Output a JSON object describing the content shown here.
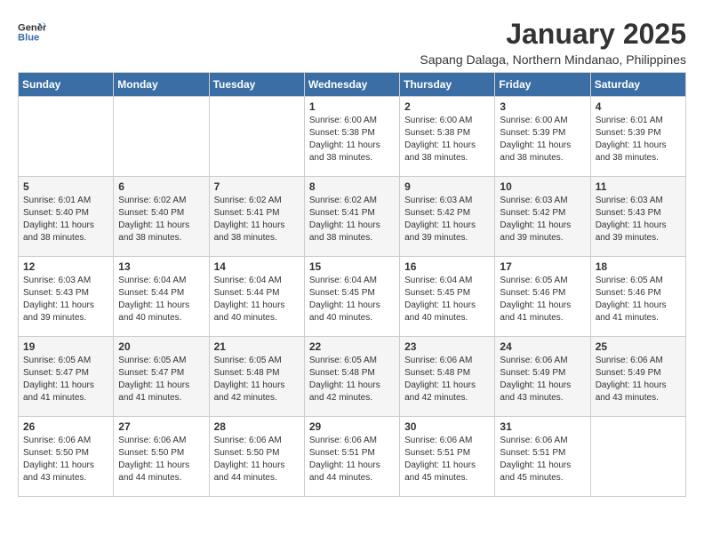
{
  "header": {
    "logo_general": "General",
    "logo_blue": "Blue",
    "month_title": "January 2025",
    "location": "Sapang Dalaga, Northern Mindanao, Philippines"
  },
  "days_of_week": [
    "Sunday",
    "Monday",
    "Tuesday",
    "Wednesday",
    "Thursday",
    "Friday",
    "Saturday"
  ],
  "weeks": [
    [
      {
        "day": "",
        "sunrise": "",
        "sunset": "",
        "daylight": ""
      },
      {
        "day": "",
        "sunrise": "",
        "sunset": "",
        "daylight": ""
      },
      {
        "day": "",
        "sunrise": "",
        "sunset": "",
        "daylight": ""
      },
      {
        "day": "1",
        "sunrise": "Sunrise: 6:00 AM",
        "sunset": "Sunset: 5:38 PM",
        "daylight": "Daylight: 11 hours and 38 minutes."
      },
      {
        "day": "2",
        "sunrise": "Sunrise: 6:00 AM",
        "sunset": "Sunset: 5:38 PM",
        "daylight": "Daylight: 11 hours and 38 minutes."
      },
      {
        "day": "3",
        "sunrise": "Sunrise: 6:00 AM",
        "sunset": "Sunset: 5:39 PM",
        "daylight": "Daylight: 11 hours and 38 minutes."
      },
      {
        "day": "4",
        "sunrise": "Sunrise: 6:01 AM",
        "sunset": "Sunset: 5:39 PM",
        "daylight": "Daylight: 11 hours and 38 minutes."
      }
    ],
    [
      {
        "day": "5",
        "sunrise": "Sunrise: 6:01 AM",
        "sunset": "Sunset: 5:40 PM",
        "daylight": "Daylight: 11 hours and 38 minutes."
      },
      {
        "day": "6",
        "sunrise": "Sunrise: 6:02 AM",
        "sunset": "Sunset: 5:40 PM",
        "daylight": "Daylight: 11 hours and 38 minutes."
      },
      {
        "day": "7",
        "sunrise": "Sunrise: 6:02 AM",
        "sunset": "Sunset: 5:41 PM",
        "daylight": "Daylight: 11 hours and 38 minutes."
      },
      {
        "day": "8",
        "sunrise": "Sunrise: 6:02 AM",
        "sunset": "Sunset: 5:41 PM",
        "daylight": "Daylight: 11 hours and 38 minutes."
      },
      {
        "day": "9",
        "sunrise": "Sunrise: 6:03 AM",
        "sunset": "Sunset: 5:42 PM",
        "daylight": "Daylight: 11 hours and 39 minutes."
      },
      {
        "day": "10",
        "sunrise": "Sunrise: 6:03 AM",
        "sunset": "Sunset: 5:42 PM",
        "daylight": "Daylight: 11 hours and 39 minutes."
      },
      {
        "day": "11",
        "sunrise": "Sunrise: 6:03 AM",
        "sunset": "Sunset: 5:43 PM",
        "daylight": "Daylight: 11 hours and 39 minutes."
      }
    ],
    [
      {
        "day": "12",
        "sunrise": "Sunrise: 6:03 AM",
        "sunset": "Sunset: 5:43 PM",
        "daylight": "Daylight: 11 hours and 39 minutes."
      },
      {
        "day": "13",
        "sunrise": "Sunrise: 6:04 AM",
        "sunset": "Sunset: 5:44 PM",
        "daylight": "Daylight: 11 hours and 40 minutes."
      },
      {
        "day": "14",
        "sunrise": "Sunrise: 6:04 AM",
        "sunset": "Sunset: 5:44 PM",
        "daylight": "Daylight: 11 hours and 40 minutes."
      },
      {
        "day": "15",
        "sunrise": "Sunrise: 6:04 AM",
        "sunset": "Sunset: 5:45 PM",
        "daylight": "Daylight: 11 hours and 40 minutes."
      },
      {
        "day": "16",
        "sunrise": "Sunrise: 6:04 AM",
        "sunset": "Sunset: 5:45 PM",
        "daylight": "Daylight: 11 hours and 40 minutes."
      },
      {
        "day": "17",
        "sunrise": "Sunrise: 6:05 AM",
        "sunset": "Sunset: 5:46 PM",
        "daylight": "Daylight: 11 hours and 41 minutes."
      },
      {
        "day": "18",
        "sunrise": "Sunrise: 6:05 AM",
        "sunset": "Sunset: 5:46 PM",
        "daylight": "Daylight: 11 hours and 41 minutes."
      }
    ],
    [
      {
        "day": "19",
        "sunrise": "Sunrise: 6:05 AM",
        "sunset": "Sunset: 5:47 PM",
        "daylight": "Daylight: 11 hours and 41 minutes."
      },
      {
        "day": "20",
        "sunrise": "Sunrise: 6:05 AM",
        "sunset": "Sunset: 5:47 PM",
        "daylight": "Daylight: 11 hours and 41 minutes."
      },
      {
        "day": "21",
        "sunrise": "Sunrise: 6:05 AM",
        "sunset": "Sunset: 5:48 PM",
        "daylight": "Daylight: 11 hours and 42 minutes."
      },
      {
        "day": "22",
        "sunrise": "Sunrise: 6:05 AM",
        "sunset": "Sunset: 5:48 PM",
        "daylight": "Daylight: 11 hours and 42 minutes."
      },
      {
        "day": "23",
        "sunrise": "Sunrise: 6:06 AM",
        "sunset": "Sunset: 5:48 PM",
        "daylight": "Daylight: 11 hours and 42 minutes."
      },
      {
        "day": "24",
        "sunrise": "Sunrise: 6:06 AM",
        "sunset": "Sunset: 5:49 PM",
        "daylight": "Daylight: 11 hours and 43 minutes."
      },
      {
        "day": "25",
        "sunrise": "Sunrise: 6:06 AM",
        "sunset": "Sunset: 5:49 PM",
        "daylight": "Daylight: 11 hours and 43 minutes."
      }
    ],
    [
      {
        "day": "26",
        "sunrise": "Sunrise: 6:06 AM",
        "sunset": "Sunset: 5:50 PM",
        "daylight": "Daylight: 11 hours and 43 minutes."
      },
      {
        "day": "27",
        "sunrise": "Sunrise: 6:06 AM",
        "sunset": "Sunset: 5:50 PM",
        "daylight": "Daylight: 11 hours and 44 minutes."
      },
      {
        "day": "28",
        "sunrise": "Sunrise: 6:06 AM",
        "sunset": "Sunset: 5:50 PM",
        "daylight": "Daylight: 11 hours and 44 minutes."
      },
      {
        "day": "29",
        "sunrise": "Sunrise: 6:06 AM",
        "sunset": "Sunset: 5:51 PM",
        "daylight": "Daylight: 11 hours and 44 minutes."
      },
      {
        "day": "30",
        "sunrise": "Sunrise: 6:06 AM",
        "sunset": "Sunset: 5:51 PM",
        "daylight": "Daylight: 11 hours and 45 minutes."
      },
      {
        "day": "31",
        "sunrise": "Sunrise: 6:06 AM",
        "sunset": "Sunset: 5:51 PM",
        "daylight": "Daylight: 11 hours and 45 minutes."
      },
      {
        "day": "",
        "sunrise": "",
        "sunset": "",
        "daylight": ""
      }
    ]
  ]
}
